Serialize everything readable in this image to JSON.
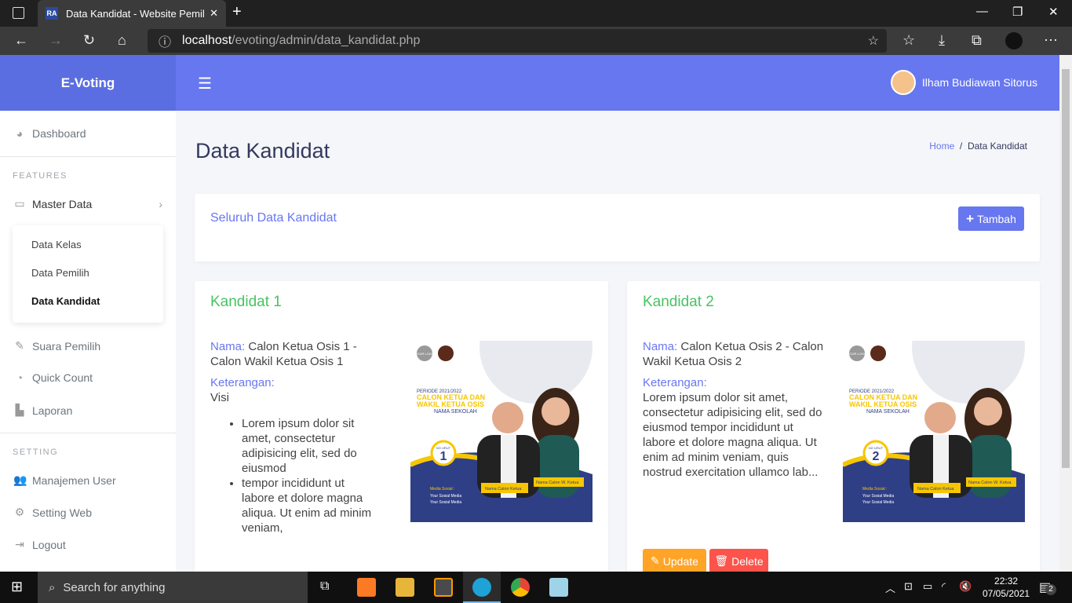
{
  "browser": {
    "tab_icon": "RA",
    "tab_title": "Data Kandidat - Website Pemilihan",
    "url_host": "localhost",
    "url_path": "/evoting/admin/data_kandidat.php"
  },
  "header": {
    "brand": "E-Voting",
    "user_name": "Ilham Budiawan Sitorus"
  },
  "sidebar": {
    "dashboard": "Dashboard",
    "features": "FEATURES",
    "master_data": "Master Data",
    "submenu": [
      "Data Kelas",
      "Data Pemilih",
      "Data Kandidat"
    ],
    "suara": "Suara Pemilih",
    "quick_count": "Quick Count",
    "laporan": "Laporan",
    "setting": "SETTING",
    "manajemen_user": "Manajemen User",
    "setting_web": "Setting Web",
    "logout": "Logout"
  },
  "page": {
    "title": "Data Kandidat",
    "breadcrumb_home": "Home",
    "breadcrumb_current": "Data Kandidat",
    "section_title": "Seluruh Data Kandidat",
    "add_button": "Tambah"
  },
  "candidates": [
    {
      "title": "Kandidat 1",
      "nama_label": "Nama:",
      "nama": "Calon Ketua Osis 1 - Calon Wakil Ketua Osis 1",
      "ket_label": "Keterangan:",
      "visi": "Visi",
      "items": [
        "Lorem ipsum dolor sit amet, consectetur adipisicing elit, sed do eiusmod",
        "tempor incididunt ut labore et dolore magna aliqua. Ut enim ad minim veniam,"
      ],
      "no_urut": "1"
    },
    {
      "title": "Kandidat 2",
      "nama_label": "Nama:",
      "nama": "Calon Ketua Osis 2 - Calon Wakil Ketua Osis 2",
      "ket_label": "Keterangan:",
      "text": "Lorem ipsum dolor sit amet, consectetur adipisicing elit, sed do eiusmod tempor incididunt ut labore et dolore magna aliqua. Ut enim ad minim veniam, quis nostrud exercitation ullamco lab...",
      "no_urut": "2",
      "update": "Update",
      "delete": "Delete"
    }
  ],
  "poster": {
    "logo": "YOUR LOGO",
    "periode": "PERIODE 2021/2022",
    "line1": "CALON KETUA DAN",
    "line2": "WAKIL KETUA OSIS",
    "school": "NAMA SEKOLAH",
    "no_urut_label": "NO URUT",
    "ketua": "Nama Calon Ketua",
    "wakil": "Nama Calon W. Ketua",
    "media": "Media Sosial :",
    "social": "Your Sosial Media"
  },
  "taskbar": {
    "search_placeholder": "Search for anything",
    "time": "22:32",
    "date": "07/05/2021",
    "notifications": "2"
  },
  "colors": {
    "primary": "#6777ef",
    "success": "#47c363",
    "warning": "#ffa426",
    "danger": "#fc544b"
  }
}
